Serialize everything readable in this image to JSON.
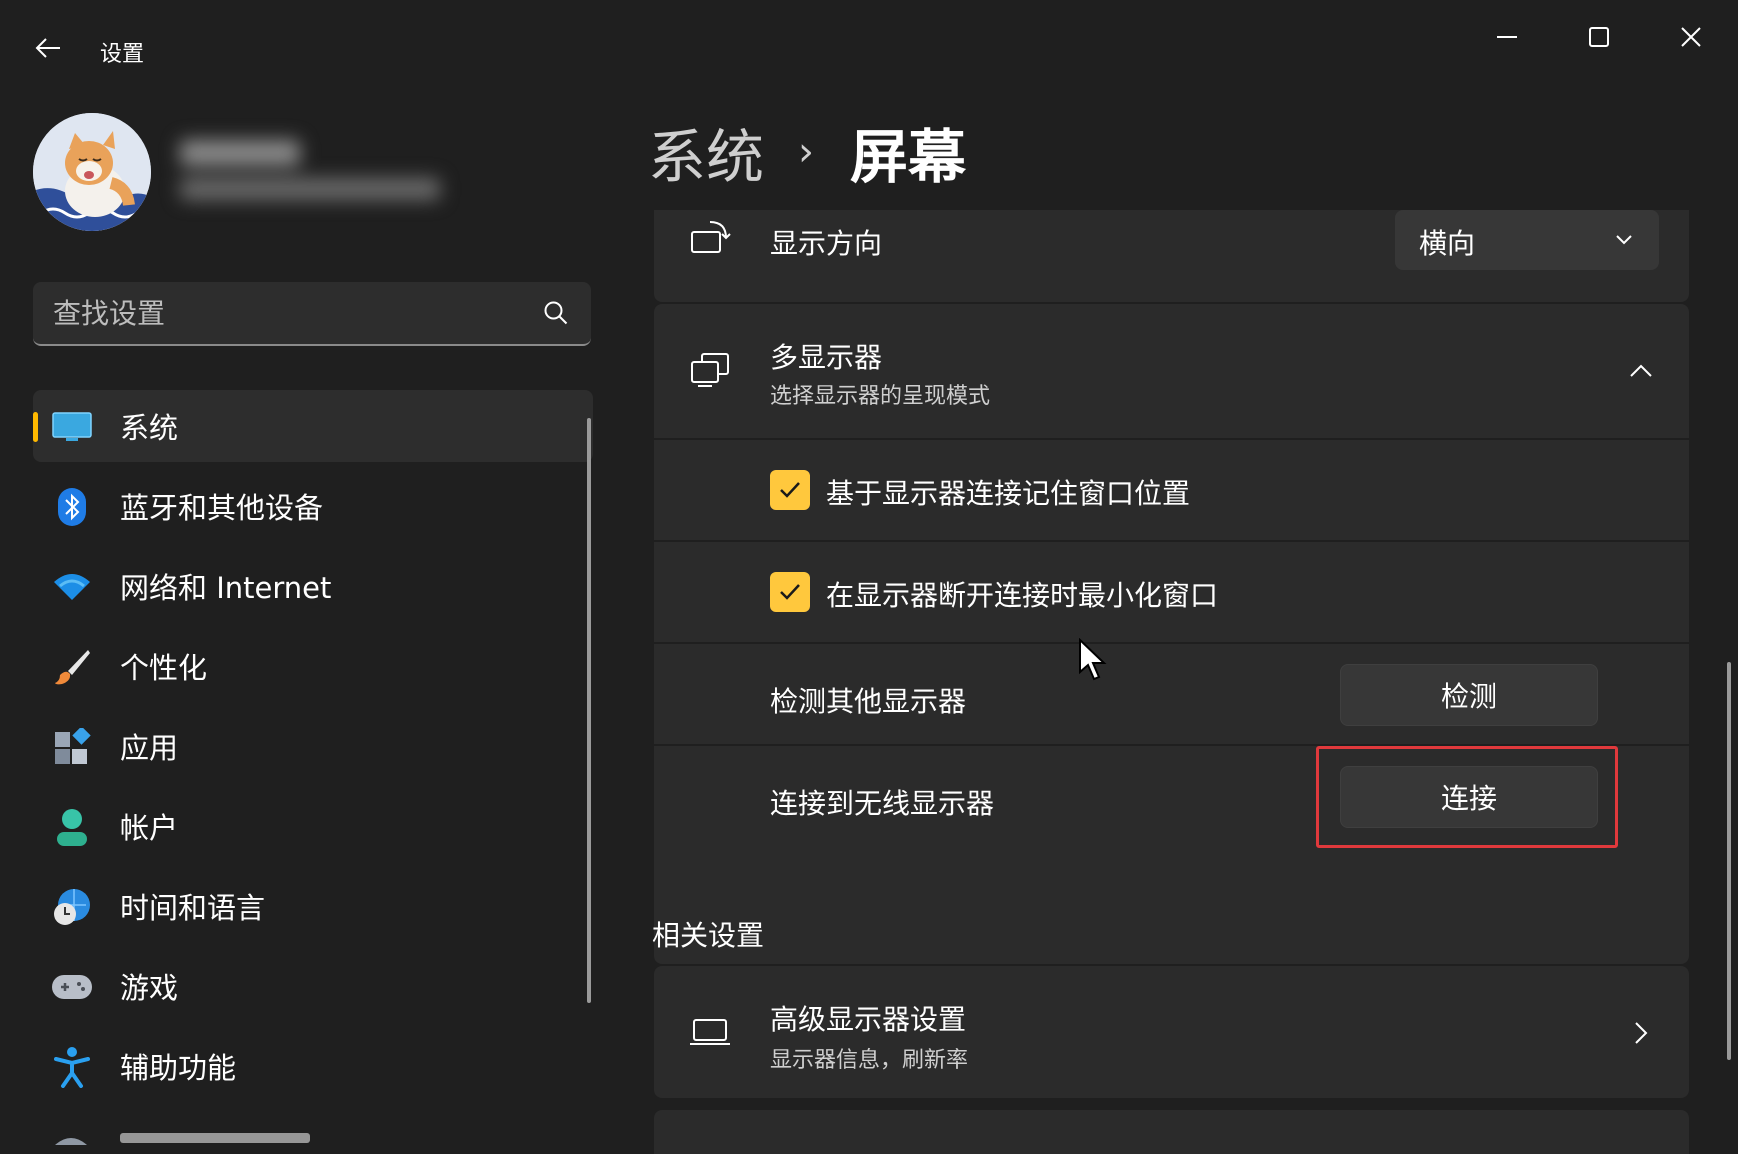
{
  "window": {
    "title": "设置",
    "controls": {
      "minimize": "minimize-icon",
      "maximize": "maximize-icon",
      "close": "close-icon"
    }
  },
  "search": {
    "placeholder": "查找设置"
  },
  "sidebar": {
    "items": [
      {
        "label": "系统",
        "icon": "system-monitor-icon",
        "active": true
      },
      {
        "label": "蓝牙和其他设备",
        "icon": "bluetooth-icon"
      },
      {
        "label": "网络和 Internet",
        "icon": "wifi-icon"
      },
      {
        "label": "个性化",
        "icon": "paintbrush-icon"
      },
      {
        "label": "应用",
        "icon": "apps-icon"
      },
      {
        "label": "帐户",
        "icon": "account-icon"
      },
      {
        "label": "时间和语言",
        "icon": "globe-clock-icon"
      },
      {
        "label": "游戏",
        "icon": "gamepad-icon"
      },
      {
        "label": "辅助功能",
        "icon": "accessibility-icon"
      }
    ]
  },
  "breadcrumb": {
    "parent": "系统",
    "separator": "›",
    "current": "屏幕"
  },
  "orientation": {
    "label": "显示方向",
    "value": "横向"
  },
  "multi_display": {
    "title": "多显示器",
    "subtitle": "选择显示器的呈现模式",
    "options": [
      {
        "label": "基于显示器连接记住窗口位置",
        "checked": true
      },
      {
        "label": "在显示器断开连接时最小化窗口",
        "checked": true
      }
    ],
    "detect": {
      "label": "检测其他显示器",
      "button": "检测"
    },
    "wireless": {
      "label": "连接到无线显示器",
      "button": "连接"
    }
  },
  "related": {
    "heading": "相关设置",
    "advanced": {
      "title": "高级显示器设置",
      "subtitle": "显示器信息，刷新率"
    }
  },
  "colors": {
    "accent": "#ffb900",
    "checkbox": "#ffc83d",
    "highlight": "#e0393c",
    "background": "#1f1f1f",
    "card": "#2b2b2b"
  }
}
